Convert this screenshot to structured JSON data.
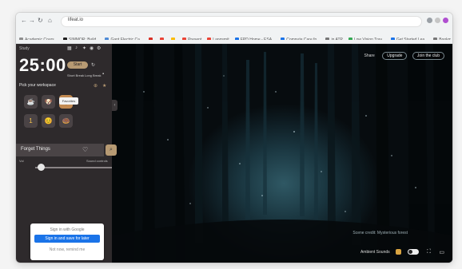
{
  "browser": {
    "address": "lifeat.io",
    "bookmarks": [
      {
        "label": "Academic Cours...",
        "color": "#8e8e8e"
      },
      {
        "label": "SIMMOR: Build...",
        "color": "#1f1f1f"
      },
      {
        "label": "Gant Electric Ca...",
        "color": "#4f8bd6"
      },
      {
        "label": "",
        "color": "#d93025"
      },
      {
        "label": "",
        "color": "#ea4335"
      },
      {
        "label": "",
        "color": "#fbbc04"
      },
      {
        "label": "Present",
        "color": "#ea4335"
      },
      {
        "label": "Langsmit",
        "color": "#ea4335"
      },
      {
        "label": "EPD Home - ESA...",
        "color": "#1a73e8"
      },
      {
        "label": "Compute Care fo...",
        "color": "#1a73e8"
      },
      {
        "label": "in ATP",
        "color": "#777777"
      },
      {
        "label": "Low Vision Trav...",
        "color": "#34a853"
      },
      {
        "label": "Get Started Lea...",
        "color": "#1a73e8"
      },
      {
        "label": "Bookmark",
        "color": "#777777"
      }
    ]
  },
  "panel": {
    "brand": "Study",
    "timer": "25:00",
    "start_label": "Start",
    "modes": [
      "Short Break",
      "Long Break"
    ],
    "workspace_title": "Pick your workspace",
    "tooltip": "Favorites",
    "tiles": [
      "☕",
      "🐶",
      "📦",
      "1",
      "😊",
      "🍩"
    ],
    "scene_name": "Forget Things",
    "slider_left": "Vol",
    "slider_right": "Sound controls",
    "volume_level": 0.05
  },
  "signin": {
    "top": "Sign in with Google",
    "button": "Sign in and save for later",
    "link": "Not now, remind me"
  },
  "scene": {
    "label": "Share",
    "btn1": "Upgrade",
    "btn2": "Join the club",
    "caption": "Scene credit: Mysterious forest",
    "ambient_label": "Ambient Sounds"
  }
}
